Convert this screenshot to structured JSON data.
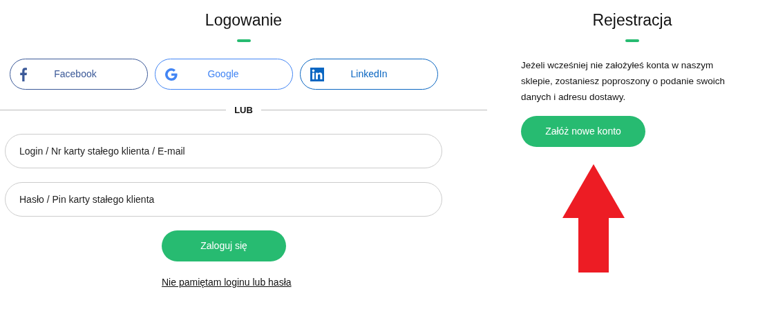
{
  "login": {
    "title": "Logowanie",
    "social_buttons": [
      {
        "kind": "facebook",
        "label": "Facebook",
        "color": "#3b5998"
      },
      {
        "kind": "google",
        "label": "Google",
        "color": "#4285f4"
      },
      {
        "kind": "linkedin",
        "label": "LinkedIn",
        "color": "#0a66c2"
      }
    ],
    "divider": "LUB",
    "fields": [
      {
        "placeholder": "Login / Nr karty stałego klienta / E-mail"
      },
      {
        "placeholder": "Hasło / Pin karty stałego klienta"
      }
    ],
    "submit": "Zaloguj się",
    "forgot_link": "Nie pamiętam loginu lub hasła"
  },
  "register": {
    "title": "Rejestracja",
    "text": "Jeżeli wcześniej nie założyłeś konta w naszym sklepie, zostaniesz poproszony o podanie swoich danych i adresu dostawy.",
    "button": "Załóż nowe konto"
  }
}
